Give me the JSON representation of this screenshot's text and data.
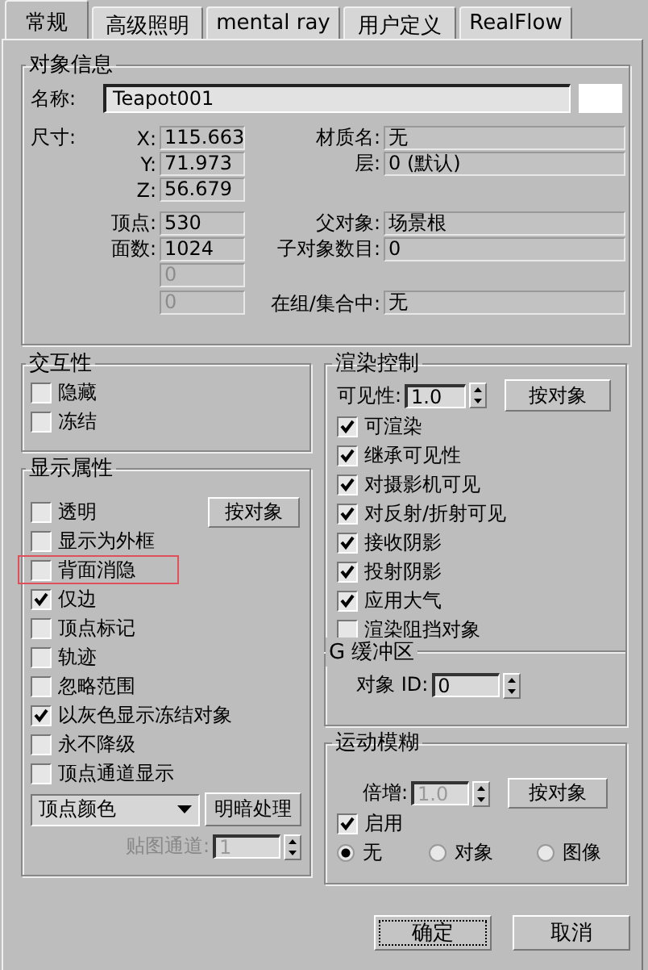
{
  "tabs": [
    {
      "label": "常规",
      "selected": true
    },
    {
      "label": "高级照明",
      "selected": false
    },
    {
      "label": "mental ray",
      "selected": false
    },
    {
      "label": "用户定义",
      "selected": false
    },
    {
      "label": "RealFlow",
      "selected": false
    }
  ],
  "object_info": {
    "title": "对象信息",
    "name_label": "名称:",
    "name_value": "Teapot001",
    "dimensions_label": "尺寸:",
    "rows": [
      {
        "left": {
          "label": "X:",
          "value": "115.663",
          "disabled": false
        },
        "right": {
          "label": "材质名:",
          "value": "无"
        }
      },
      {
        "left": {
          "label": "Y:",
          "value": "71.973",
          "disabled": false
        },
        "right": {
          "label": "层:",
          "value": "0 (默认)"
        }
      },
      {
        "left": {
          "label": "Z:",
          "value": "56.679",
          "disabled": false
        }
      },
      {
        "left": {
          "label": "顶点:",
          "value": "530",
          "disabled": false
        },
        "right": {
          "label": "父对象:",
          "value": "场景根"
        }
      },
      {
        "left": {
          "label": "面数:",
          "value": "1024",
          "disabled": false
        },
        "right": {
          "label": "子对象数目:",
          "value": "0"
        }
      },
      {
        "left": {
          "value": "0",
          "disabled": true
        }
      },
      {
        "left": {
          "value": "0",
          "disabled": true
        },
        "right": {
          "label": "在组/集合中:",
          "value": "无"
        }
      }
    ]
  },
  "interactivity": {
    "title": "交互性",
    "options": [
      {
        "label": "隐藏",
        "checked": false
      },
      {
        "label": "冻结",
        "checked": false
      }
    ]
  },
  "display": {
    "title": "显示属性",
    "button": "按对象",
    "options": [
      {
        "label": "透明",
        "checked": false,
        "highlighted": false
      },
      {
        "label": "显示为外框",
        "checked": false,
        "highlighted": false
      },
      {
        "label": "背面消隐",
        "checked": false,
        "highlighted": true
      },
      {
        "label": "仅边",
        "checked": true,
        "highlighted": false
      },
      {
        "label": "顶点标记",
        "checked": false,
        "highlighted": false
      },
      {
        "label": "轨迹",
        "checked": false,
        "highlighted": false
      },
      {
        "label": "忽略范围",
        "checked": false,
        "highlighted": false
      },
      {
        "label": "以灰色显示冻结对象",
        "checked": true,
        "highlighted": false
      },
      {
        "label": "永不降级",
        "checked": false,
        "highlighted": false
      },
      {
        "label": "顶点通道显示",
        "checked": false,
        "highlighted": false
      }
    ],
    "dropdown": {
      "value": "顶点颜色"
    },
    "shade_button": "明暗处理",
    "map_channel": {
      "label": "贴图通道:",
      "value": "1",
      "disabled": true
    }
  },
  "render": {
    "title": "渲染控制",
    "visibility": {
      "label": "可见性:",
      "value": "1.0"
    },
    "button": "按对象",
    "options": [
      {
        "label": "可渲染",
        "checked": true
      },
      {
        "label": "继承可见性",
        "checked": true
      },
      {
        "label": "对摄影机可见",
        "checked": true
      },
      {
        "label": "对反射/折射可见",
        "checked": true
      },
      {
        "label": "接收阴影",
        "checked": true
      },
      {
        "label": "投射阴影",
        "checked": true
      },
      {
        "label": "应用大气",
        "checked": true
      },
      {
        "label": "渲染阻挡对象",
        "checked": false
      }
    ],
    "gbuffer": {
      "title": "G 缓冲区",
      "label": "对象 ID:",
      "value": "0"
    }
  },
  "motion_blur": {
    "title": "运动模糊",
    "multiplier": {
      "label": "倍增:",
      "value": "1.0",
      "disabled": true
    },
    "button": "按对象",
    "enabled": {
      "label": "启用",
      "checked": true
    },
    "modes": [
      {
        "label": "无",
        "selected": true
      },
      {
        "label": "对象",
        "selected": false
      },
      {
        "label": "图像",
        "selected": false
      }
    ]
  },
  "buttons": [
    {
      "label": "确定",
      "focused": true
    },
    {
      "label": "取消",
      "focused": false
    }
  ]
}
